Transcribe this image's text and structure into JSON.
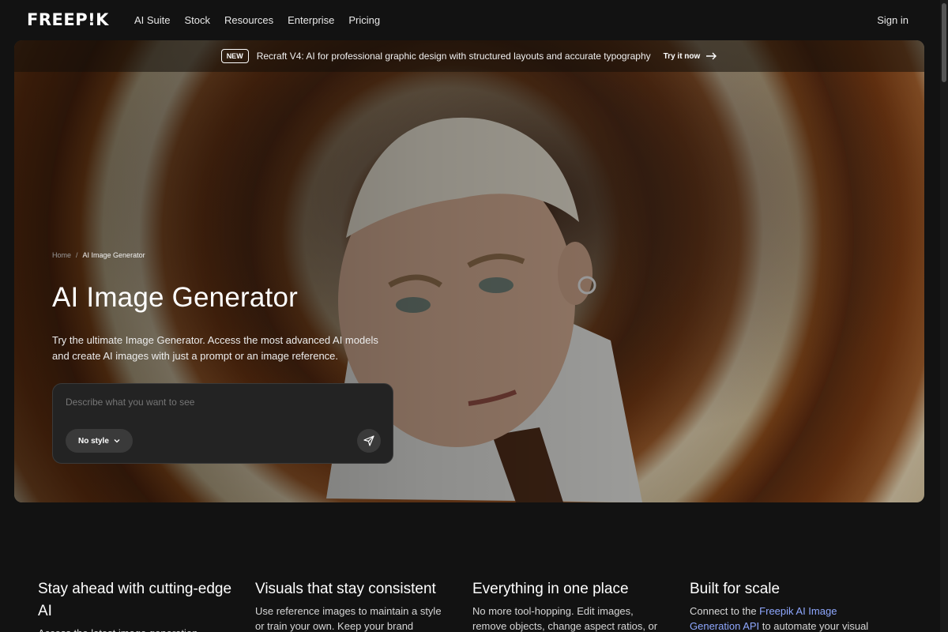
{
  "nav": {
    "logo": "FREEP!K",
    "links": [
      "AI Suite",
      "Stock",
      "Resources",
      "Enterprise",
      "Pricing"
    ],
    "signin": "Sign in"
  },
  "announcement": {
    "badge": "NEW",
    "text": "Recraft V4: AI for professional graphic design with structured layouts and accurate typography",
    "link": "Try it now"
  },
  "hero": {
    "breadcrumb_home": "Home",
    "breadcrumb_sep": "/",
    "breadcrumb_current": "AI Image Generator",
    "title": "AI Image Generator",
    "description": "Try the ultimate Image Generator. Access the most advanced AI models and create AI images with just a prompt or an image reference.",
    "prompt_placeholder": "Describe what you want to see",
    "style_label": "No style"
  },
  "features": [
    {
      "title": "Stay ahead with cutting-edge AI",
      "text": "Access the latest image generation"
    },
    {
      "title": "Visuals that stay consistent",
      "text": "Use reference images to maintain a style or train your own. Keep your brand"
    },
    {
      "title": "Everything in one place",
      "text": "No more tool-hopping. Edit images, remove objects, change aspect ratios, or"
    },
    {
      "title": "Built for scale",
      "text_before": "Connect to the ",
      "link": "Freepik AI Image Generation API",
      "text_after": " to automate your visual"
    }
  ]
}
